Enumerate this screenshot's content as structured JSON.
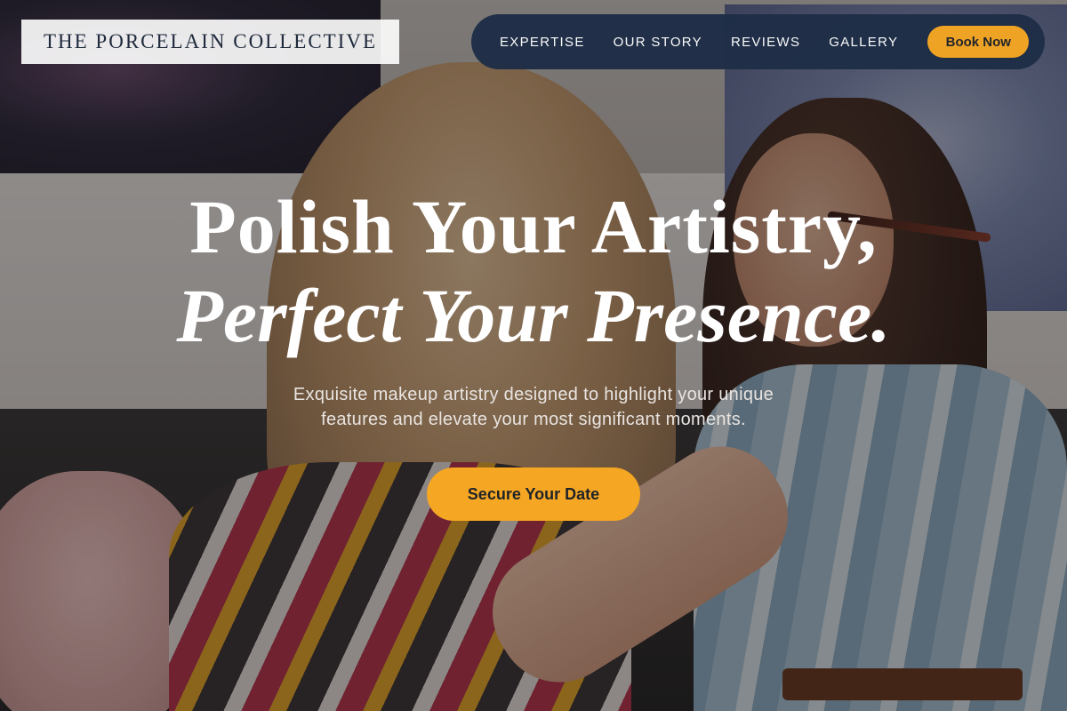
{
  "brand": {
    "logo_text": "THE PORCELAIN COLLECTIVE"
  },
  "nav": {
    "links": [
      "EXPERTISE",
      "OUR STORY",
      "REVIEWS",
      "GALLERY"
    ],
    "cta_label": "Book Now"
  },
  "hero": {
    "headline_line1": "Polish Your Artistry,",
    "headline_line2": "Perfect Your Presence.",
    "subtitle_line1": "Exquisite makeup artistry designed to highlight your unique",
    "subtitle_line2": "features and elevate your most significant moments.",
    "cta_label": "Secure Your Date",
    "background_image": "makeup-artist-applying-eyeshadow-photo"
  },
  "colors": {
    "accent": "#f5a623",
    "nav_background": "#1f2e47",
    "logo_text": "#1f2a3c"
  }
}
